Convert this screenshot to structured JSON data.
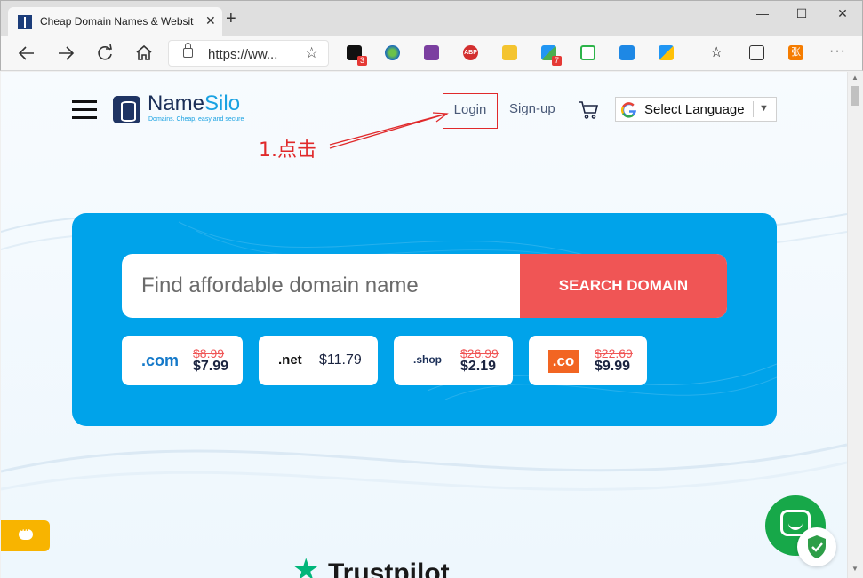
{
  "browser": {
    "tab_title": "Cheap Domain Names & Websit",
    "tab_close": "✕",
    "new_tab": "+",
    "url": "https://ww...",
    "window_controls": {
      "minimize": "—",
      "maximize": "☐",
      "close": "✕"
    },
    "extension_badges": {
      "ext1": "3",
      "ext8": "7"
    },
    "abp_label": "ABP",
    "user_ext_label": "张",
    "menu": "···"
  },
  "header": {
    "logo_name_a": "Name",
    "logo_name_b": "Silo",
    "logo_tagline": "Domains. Cheap, easy and secure",
    "login": "Login",
    "signup": "Sign-up",
    "language_select": "Select Language",
    "language_arrow": "▼"
  },
  "annotation": "1.点击",
  "hero": {
    "search_placeholder": "Find affordable domain name",
    "search_button": "SEARCH DOMAIN",
    "tlds": [
      {
        "name": ".com",
        "old_price": "$8.99",
        "price": "$7.99"
      },
      {
        "name": ".net",
        "old_price": "",
        "price": "$11.79"
      },
      {
        "name": ".shop",
        "old_price": "$26.99",
        "price": "$2.19"
      },
      {
        "name": ".co",
        "old_price": "$22.69",
        "price": "$9.99"
      }
    ]
  },
  "trustpilot": "Trustpilot",
  "colors": {
    "hero_blue": "#00a3ea",
    "search_red": "#f05555",
    "annotation_red": "#e0292b",
    "chat_green": "#17a849",
    "chat_yellow": "#f8b400"
  }
}
